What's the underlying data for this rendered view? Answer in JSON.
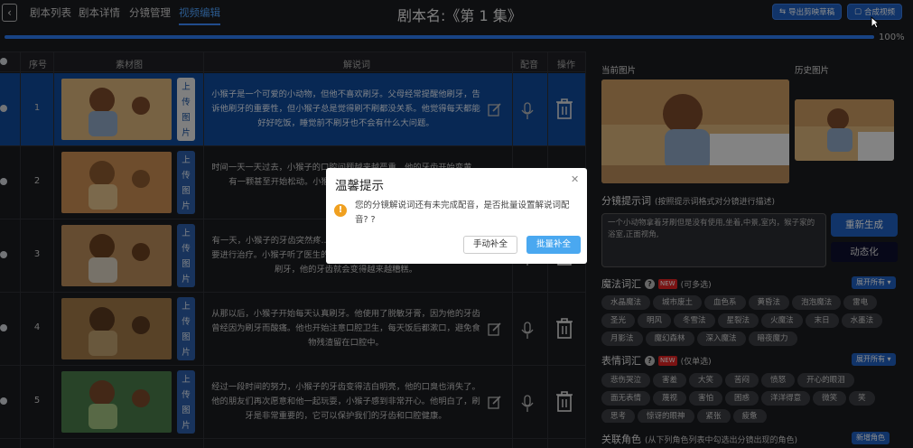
{
  "header": {
    "back_icon": "chevron-left-icon",
    "nav_tabs": [
      "剧本列表",
      "剧本详情",
      "分镜管理",
      "视频编辑"
    ],
    "active_tab": "视频编辑",
    "title": "剧本名:《第 1 集》",
    "export_button": "导出剪映草稿",
    "compose_button": "合成视频",
    "progress_label": "100%",
    "progress_fraction": 1.0
  },
  "table": {
    "columns": [
      "序号",
      "素材图",
      "解说词",
      "配音",
      "操作"
    ],
    "upload_label": "上传图片",
    "rows": [
      {
        "index": "1",
        "selected": true,
        "narration": "小猴子是一个可爱的小动物，但他不喜欢刷牙。父母经常提醒他刷牙，告诉他刷牙的重要性，但小猴子总是觉得刷不刷都没关系。他觉得每天都能好好吃饭，睡觉前不刷牙也不会有什么大问题。"
      },
      {
        "index": "2",
        "selected": false,
        "narration": "时间一天一天过去，小猴子的口腔问题越来越严重。他的牙齿开始变黄，有一颗甚至开始松动。小猴子...时，他们都捂着鼻子，不愿意..."
      },
      {
        "index": "3",
        "selected": false,
        "narration": "有一天，小猴子的牙齿突然疼...常担心，带他去看了医生。医生...染，需要进行治疗。小猴子听了医生的话，感到非常害怕。他意识到，如果他不刷牙，他的牙齿就会变得越来越糟糕。"
      },
      {
        "index": "4",
        "selected": false,
        "narration": "从那以后，小猴子开始每天认真刷牙。他使用了脱敏牙膏，因为他的牙齿曾经因为刷牙而酸痛。他也开始注意口腔卫生，每天饭后都漱口，避免食物残渣留在口腔中。"
      },
      {
        "index": "5",
        "selected": false,
        "narration": "经过一段时间的努力，小猴子的牙齿变得洁白明亮，他的口臭也消失了。他的朋友们再次愿意和他一起玩耍，小猴子感到非常开心。他明白了，刷牙是非常重要的，它可以保护我们的牙齿和口腔健康。"
      }
    ]
  },
  "panel": {
    "current_image_label": "当前图片",
    "history_image_label": "历史图片",
    "hint_title": "分镜提示词",
    "hint_subtitle": "(按照提示词格式对分镜进行描述)",
    "hint_text": "一个小动物拿着牙刷但是没有使用,坐着,中景,室内，猴子家的浴室,正面视角,",
    "regenerate_button": "重新生成",
    "dynamic_button": "动态化",
    "magic_title": "魔法词汇",
    "magic_sub": "(可多选)",
    "expand_all": "展开所有",
    "magic_tags": [
      "水晶魔法",
      "城市废土",
      "血色系",
      "黄昏法",
      "泡泡魔法",
      "雷电",
      "圣光",
      "明风",
      "冬雪法",
      "星裂法",
      "火魔法",
      "末日",
      "水墨法",
      "月影法",
      "魔幻森林",
      "深入魔法",
      "暗夜魔力"
    ],
    "expression_title": "表情词汇",
    "expression_sub": "(仅单选)",
    "expand_all_2": "展开所有",
    "expression_tags": [
      "悲伤哭泣",
      "害羞",
      "大笑",
      "苦闷",
      "愤怒",
      "开心的眼泪",
      "面无表情",
      "蔑视",
      "害怕",
      "困惑",
      "洋洋得意",
      "微笑",
      "笑",
      "思考",
      "惊讶的眼神",
      "紧张",
      "疲惫"
    ],
    "role_title": "关联角色",
    "role_sub": "(从下列角色列表中勾选出分镜出现的角色)",
    "add_role_button": "新增角色",
    "new_badge": "NEW"
  },
  "dialog": {
    "title": "温馨提示",
    "message": "您的分镜解说词还有未完成配音，是否批量设置解说词配音? ?",
    "manual_button": "手动补全",
    "batch_button": "批量补全"
  }
}
